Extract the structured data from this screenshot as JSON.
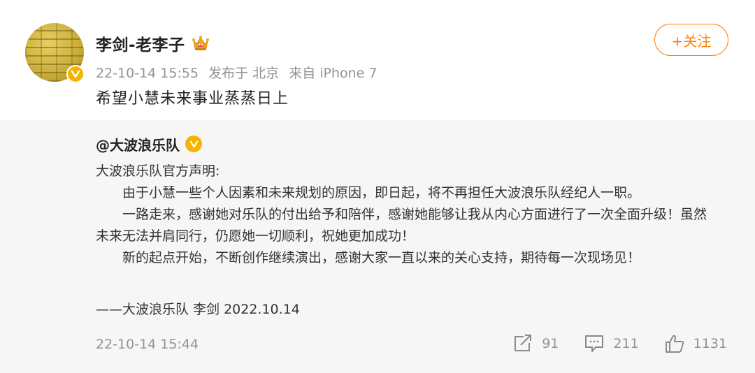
{
  "post": {
    "username": "李剑-老李子",
    "timestamp": "22-10-14 15:55",
    "published_in": "发布于 北京",
    "source": "来自 iPhone 7",
    "follow_label": "+关注",
    "text": "希望小慧未来事业蒸蒸日上"
  },
  "retweet": {
    "author": "@大波浪乐队",
    "statement_title": "大波浪乐队官方声明:",
    "paragraph_1": "由于小慧一些个人因素和未来规划的原因，即日起，将不再担任大波浪乐队经纪人一职。",
    "paragraph_2": "一路走来，感谢她对乐队的付出给予和陪伴，感谢她能够让我从内心方面进行了一次全面升级！虽然未来无法并肩同行，仍愿她一切顺利，祝她更加成功！",
    "paragraph_3": "新的起点开始，不断创作继续演出，感谢大家一直以来的关心支持，期待每一次现场见！",
    "signature": "——大波浪乐队 李剑 2022.10.14",
    "timestamp": "22-10-14 15:44",
    "repost_count": "91",
    "comment_count": "211",
    "like_count": "1131"
  },
  "colors": {
    "accent": "#ff8200",
    "verified": "#f5b400",
    "muted": "#939393",
    "retweet_bg": "#f6f6f6"
  },
  "icons": [
    "verified-icon",
    "crown-icon",
    "repost-icon",
    "comment-icon",
    "like-icon"
  ]
}
